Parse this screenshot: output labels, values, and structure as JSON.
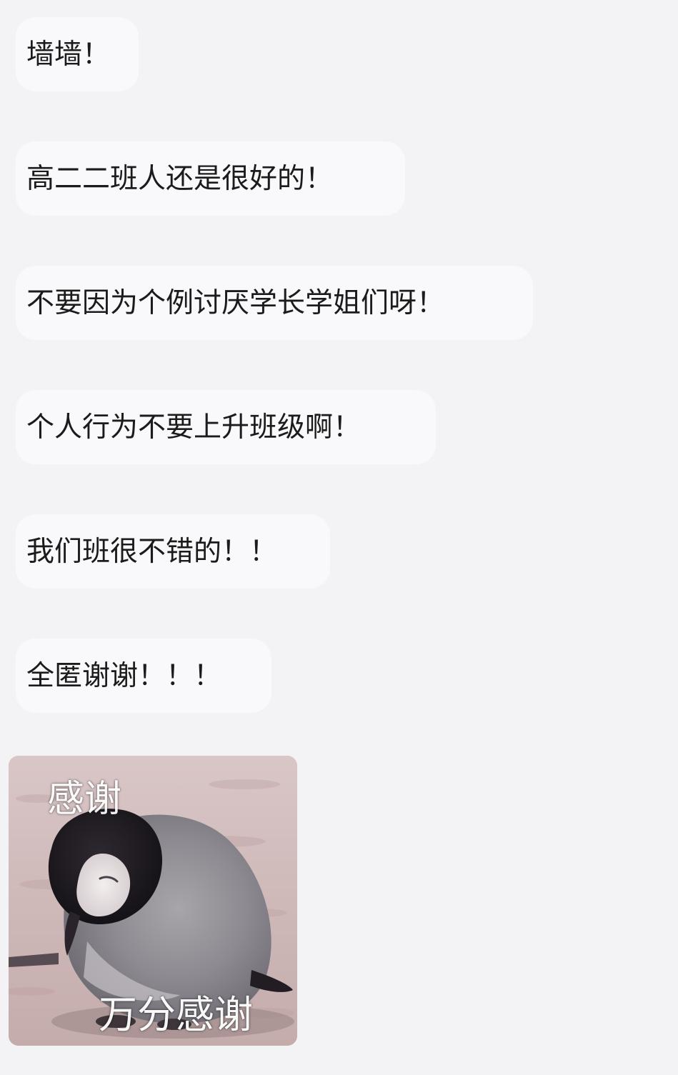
{
  "messages": [
    {
      "text": "墙墙！"
    },
    {
      "text": "高二二班人还是很好的！"
    },
    {
      "text": "不要因为个例讨厌学长学姐们呀！"
    },
    {
      "text": "个人行为不要上升班级啊！"
    },
    {
      "text": "我们班很不错的！！"
    },
    {
      "text": "全匿谢谢！！！"
    }
  ],
  "sticker": {
    "caption_top": "感谢",
    "caption_bottom": "万分感谢",
    "icon": "penguin-chick-sticker"
  },
  "colors": {
    "background": "#f3f3f5",
    "bubble": "#f9f9fb",
    "text": "#1b1b1b"
  }
}
